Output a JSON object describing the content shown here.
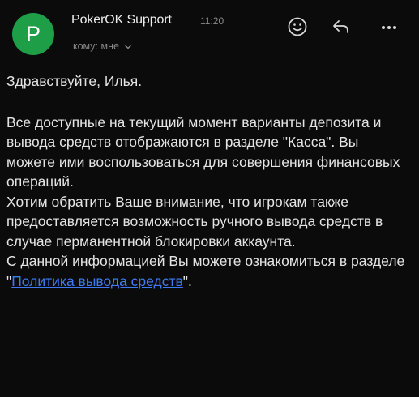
{
  "email": {
    "avatar_letter": "P",
    "sender": "PokerOK Support",
    "time": "11:20",
    "recipient": "кому: мне",
    "greeting": "Здравствуйте, Илья.",
    "p1": "Все доступные на текущий момент варианты депозита и вывода средств отображаются в разделе \"Касса\". Вы можете ими воспользоваться для совершения финансовых операций.",
    "p2": "Хотим обратить Ваше внимание, что игрокам также предоставляется возможность ручного вывода средств в случае перманентной блокировки аккаунта.",
    "p3_before": "С данной информацией Вы можете ознакомиться в разделе \"",
    "p3_link": "Политика вывода средств",
    "p3_after": "\".",
    "avatar_color": "#1e9e47",
    "link_color": "#3d7bf5",
    "icons": [
      "smile-icon",
      "reply-icon",
      "more-icon",
      "chevron-down-icon"
    ]
  }
}
